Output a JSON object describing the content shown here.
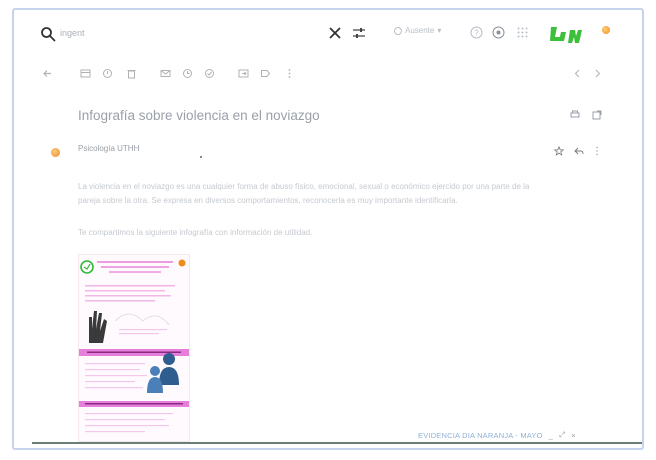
{
  "search": {
    "query": "ingent"
  },
  "status": {
    "label": "Ausente"
  },
  "email": {
    "subject": "Infografía sobre violencia en el noviazgo",
    "sender": "Psicología UTHH",
    "paragraph_1_line_1": "La violencia en el noviazgo es una cualquier forma de abuso físico, emocional, sexual o económico ejercido por una parte de la",
    "paragraph_1_line_2": "pareja sobre la otra. Se expresa en diversos comportamientos, reconocerla es muy importante identificarla.",
    "paragraph_2": "Te compartimos la siguiente infografía con información de utilidad.",
    "attachment": {
      "title": "EVIDENCIA DIA NARANJA - MAYO"
    }
  },
  "colors": {
    "accent_green": "#3cc03c",
    "avatar_orange": "#f08a1c",
    "infographic_pink": "#e25bcf",
    "frame_border": "#c5d4ea"
  },
  "icons": {
    "top": [
      "help-icon",
      "settings-icon",
      "apps-grid-icon"
    ],
    "toolbar": [
      "back-arrow-icon",
      "archive-icon",
      "report-icon",
      "delete-icon",
      "mark-unread-icon",
      "snooze-icon",
      "add-task-icon",
      "move-icon",
      "label-icon",
      "more-icon"
    ]
  }
}
